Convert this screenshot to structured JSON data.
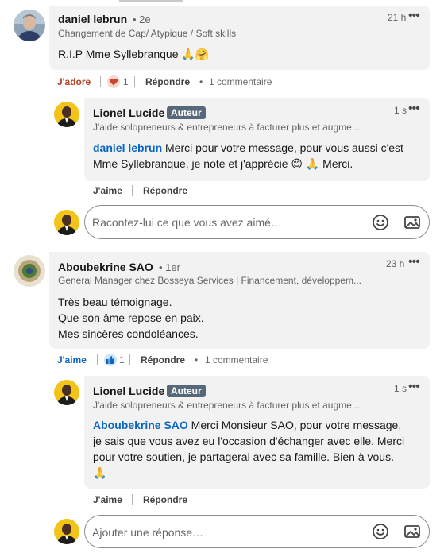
{
  "comments": [
    {
      "author": "daniel lebrun",
      "degree": "• 2e",
      "headline": "Changement de Cap/ Atypique / Soft skills",
      "time": "21 h",
      "text": "R.I.P Mme Syllebranque 🙏🤗",
      "actions": {
        "reaction_label": "J'adore",
        "reaction_count": "1",
        "reply": "Répondre",
        "replies": "1 commentaire"
      },
      "reply": {
        "author": "Lionel Lucide",
        "badge": "Auteur",
        "headline": "J'aide solopreneurs & entrepreneurs à facturer plus et augme...",
        "time": "1 s",
        "mention": "daniel lebrun",
        "text_lines": [
          " Merci pour votre message, pour vous aussi c'est",
          "Mme Syllebranque, je note et j'apprécie 😊 🙏 Merci."
        ],
        "like": "J'aime",
        "reply": "Répondre"
      },
      "input_placeholder": "Racontez-lui ce que vous avez aimé…"
    },
    {
      "author": "Aboubekrine SAO",
      "degree": "• 1er",
      "headline": "General Manager chez Bosseya Services | Financement, développem...",
      "time": "23 h",
      "text_lines": [
        "Très beau témoignage.",
        "Que son âme repose en paix.",
        "Mes sincères condoléances."
      ],
      "actions": {
        "reaction_label": "J'aime",
        "reaction_count": "1",
        "reply": "Répondre",
        "replies": "1 commentaire"
      },
      "reply": {
        "author": "Lionel Lucide",
        "badge": "Auteur",
        "headline": "J'aide solopreneurs & entrepreneurs à facturer plus et augme...",
        "time": "1 s",
        "mention": "Aboubekrine SAO",
        "text_lines": [
          " Merci Monsieur SAO, pour votre message,",
          "je sais que vous avez eu l'occasion d'échanger avec elle. Merci",
          "pour votre soutien, je partagerai avec sa famille. Bien à vous.",
          "🙏"
        ],
        "like": "J'aime",
        "reply": "Répondre"
      },
      "input_placeholder": "Ajouter une réponse…"
    }
  ],
  "icons": {
    "more": "ellipsis-icon",
    "emoji": "emoji-icon",
    "image": "image-icon",
    "heart": "heart-reaction-icon",
    "like": "like-reaction-icon"
  },
  "colors": {
    "link": "#0a66c2",
    "love": "#b24020",
    "bubble": "#f2f2f2",
    "badge": "#56687a"
  }
}
